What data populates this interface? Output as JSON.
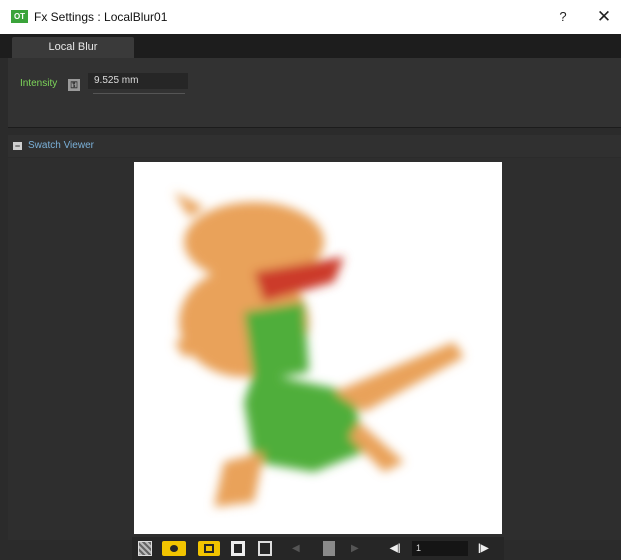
{
  "window": {
    "app_icon_text": "OT",
    "title": "Fx Settings : LocalBlur01",
    "help_label": "?",
    "close_label": "✕"
  },
  "tabs": [
    {
      "label": "Local Blur"
    }
  ],
  "settings": {
    "intensity_label": "Intensity",
    "intensity_value": "9.525 mm"
  },
  "swatch": {
    "collapse_label": "−",
    "title": "Swatch Viewer"
  },
  "toolbar": {
    "icons": [
      "checkerboard-icon",
      "eye-icon",
      "white-bg-icon",
      "black-bg-icon",
      "frame-icon",
      "prev-icon",
      "lock-icon",
      "next-icon",
      "frame-back-icon",
      "frame-forward-icon"
    ],
    "prev_label": "◀",
    "next_label": "▶",
    "frame_back_label": "◀|",
    "frame_forward_label": "|▶",
    "frame_value": "1"
  },
  "colors": {
    "accent_yellow": "#f2c400",
    "label_green": "#7dd65a",
    "label_blue": "#7ab0d8"
  }
}
